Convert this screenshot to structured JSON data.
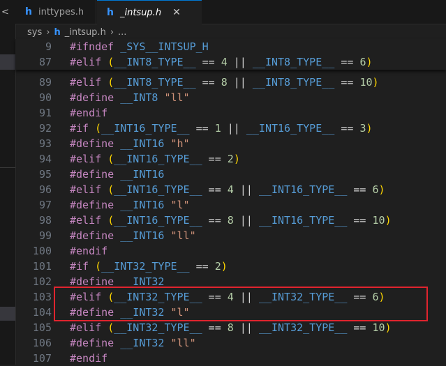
{
  "tabs": [
    {
      "label": "inttypes.h",
      "icon": "h-file-icon",
      "active": false
    },
    {
      "label": "_intsup.h",
      "icon": "h-file-icon",
      "active": true
    }
  ],
  "tab_close_glyph": "✕",
  "breadcrumb": {
    "folder": "sys",
    "file": "_intsup.h",
    "more": "..."
  },
  "icons": {
    "file_letter": "h"
  },
  "colors": {
    "highlight_border": "#e0242e",
    "accent": "#3794ff"
  },
  "sticky_lines": [
    {
      "num": "9",
      "parts": [
        [
          "kw",
          "#ifndef"
        ],
        [
          "op",
          " "
        ],
        [
          "mac",
          "_SYS__INTSUP_H"
        ]
      ]
    },
    {
      "num": "87",
      "parts": [
        [
          "kw",
          "#elif"
        ],
        [
          "op",
          " "
        ],
        [
          "pa",
          "("
        ],
        [
          "mac",
          "__INT8_TYPE__"
        ],
        [
          "op",
          " == "
        ],
        [
          "num",
          "4"
        ],
        [
          "op",
          " || "
        ],
        [
          "mac",
          "__INT8_TYPE__"
        ],
        [
          "op",
          " == "
        ],
        [
          "num",
          "6"
        ],
        [
          "pa",
          ")"
        ]
      ]
    }
  ],
  "lines": [
    {
      "num": "89",
      "parts": [
        [
          "kw",
          "#elif"
        ],
        [
          "op",
          " "
        ],
        [
          "pa",
          "("
        ],
        [
          "mac",
          "__INT8_TYPE__"
        ],
        [
          "op",
          " == "
        ],
        [
          "num",
          "8"
        ],
        [
          "op",
          " || "
        ],
        [
          "mac",
          "__INT8_TYPE__"
        ],
        [
          "op",
          " == "
        ],
        [
          "num",
          "10"
        ],
        [
          "pa",
          ")"
        ]
      ]
    },
    {
      "num": "90",
      "parts": [
        [
          "kw",
          "#define"
        ],
        [
          "op",
          " "
        ],
        [
          "mac",
          "__INT8"
        ],
        [
          "op",
          " "
        ],
        [
          "str",
          "\"ll\""
        ]
      ]
    },
    {
      "num": "91",
      "parts": [
        [
          "kw",
          "#endif"
        ]
      ]
    },
    {
      "num": "92",
      "parts": [
        [
          "kw",
          "#if"
        ],
        [
          "op",
          " "
        ],
        [
          "pa",
          "("
        ],
        [
          "mac",
          "__INT16_TYPE__"
        ],
        [
          "op",
          " == "
        ],
        [
          "num",
          "1"
        ],
        [
          "op",
          " || "
        ],
        [
          "mac",
          "__INT16_TYPE__"
        ],
        [
          "op",
          " == "
        ],
        [
          "num",
          "3"
        ],
        [
          "pa",
          ")"
        ]
      ]
    },
    {
      "num": "93",
      "parts": [
        [
          "kw",
          "#define"
        ],
        [
          "op",
          " "
        ],
        [
          "mac",
          "__INT16"
        ],
        [
          "op",
          " "
        ],
        [
          "str",
          "\"h\""
        ]
      ]
    },
    {
      "num": "94",
      "parts": [
        [
          "kw",
          "#elif"
        ],
        [
          "op",
          " "
        ],
        [
          "pa",
          "("
        ],
        [
          "mac",
          "__INT16_TYPE__"
        ],
        [
          "op",
          " == "
        ],
        [
          "num",
          "2"
        ],
        [
          "pa",
          ")"
        ]
      ]
    },
    {
      "num": "95",
      "parts": [
        [
          "kw",
          "#define"
        ],
        [
          "op",
          " "
        ],
        [
          "mac",
          "__INT16"
        ]
      ]
    },
    {
      "num": "96",
      "parts": [
        [
          "kw",
          "#elif"
        ],
        [
          "op",
          " "
        ],
        [
          "pa",
          "("
        ],
        [
          "mac",
          "__INT16_TYPE__"
        ],
        [
          "op",
          " == "
        ],
        [
          "num",
          "4"
        ],
        [
          "op",
          " || "
        ],
        [
          "mac",
          "__INT16_TYPE__"
        ],
        [
          "op",
          " == "
        ],
        [
          "num",
          "6"
        ],
        [
          "pa",
          ")"
        ]
      ]
    },
    {
      "num": "97",
      "parts": [
        [
          "kw",
          "#define"
        ],
        [
          "op",
          " "
        ],
        [
          "mac",
          "__INT16"
        ],
        [
          "op",
          " "
        ],
        [
          "str",
          "\"l\""
        ]
      ]
    },
    {
      "num": "98",
      "parts": [
        [
          "kw",
          "#elif"
        ],
        [
          "op",
          " "
        ],
        [
          "pa",
          "("
        ],
        [
          "mac",
          "__INT16_TYPE__"
        ],
        [
          "op",
          " == "
        ],
        [
          "num",
          "8"
        ],
        [
          "op",
          " || "
        ],
        [
          "mac",
          "__INT16_TYPE__"
        ],
        [
          "op",
          " == "
        ],
        [
          "num",
          "10"
        ],
        [
          "pa",
          ")"
        ]
      ]
    },
    {
      "num": "99",
      "parts": [
        [
          "kw",
          "#define"
        ],
        [
          "op",
          " "
        ],
        [
          "mac",
          "__INT16"
        ],
        [
          "op",
          " "
        ],
        [
          "str",
          "\"ll\""
        ]
      ]
    },
    {
      "num": "100",
      "parts": [
        [
          "kw",
          "#endif"
        ]
      ]
    },
    {
      "num": "101",
      "parts": [
        [
          "kw",
          "#if"
        ],
        [
          "op",
          " "
        ],
        [
          "pa",
          "("
        ],
        [
          "mac",
          "__INT32_TYPE__"
        ],
        [
          "op",
          " == "
        ],
        [
          "num",
          "2"
        ],
        [
          "pa",
          ")"
        ]
      ]
    },
    {
      "num": "102",
      "parts": [
        [
          "kw",
          "#define"
        ],
        [
          "op",
          " "
        ],
        [
          "mac",
          "__INT32"
        ]
      ]
    },
    {
      "num": "103",
      "parts": [
        [
          "kw",
          "#elif"
        ],
        [
          "op",
          " "
        ],
        [
          "pa",
          "("
        ],
        [
          "mac",
          "__INT32_TYPE__"
        ],
        [
          "op",
          " == "
        ],
        [
          "num",
          "4"
        ],
        [
          "op",
          " || "
        ],
        [
          "mac",
          "__INT32_TYPE__"
        ],
        [
          "op",
          " == "
        ],
        [
          "num",
          "6"
        ],
        [
          "pa",
          ")"
        ]
      ]
    },
    {
      "num": "104",
      "parts": [
        [
          "kw",
          "#define"
        ],
        [
          "op",
          " "
        ],
        [
          "mac",
          "__INT32"
        ],
        [
          "op",
          " "
        ],
        [
          "str",
          "\"l\""
        ]
      ]
    },
    {
      "num": "105",
      "parts": [
        [
          "kw",
          "#elif"
        ],
        [
          "op",
          " "
        ],
        [
          "pa",
          "("
        ],
        [
          "mac",
          "__INT32_TYPE__"
        ],
        [
          "op",
          " == "
        ],
        [
          "num",
          "8"
        ],
        [
          "op",
          " || "
        ],
        [
          "mac",
          "__INT32_TYPE__"
        ],
        [
          "op",
          " == "
        ],
        [
          "num",
          "10"
        ],
        [
          "pa",
          ")"
        ]
      ]
    },
    {
      "num": "106",
      "parts": [
        [
          "kw",
          "#define"
        ],
        [
          "op",
          " "
        ],
        [
          "mac",
          "__INT32"
        ],
        [
          "op",
          " "
        ],
        [
          "str",
          "\"ll\""
        ]
      ]
    },
    {
      "num": "107",
      "parts": [
        [
          "kw",
          "#endif"
        ]
      ]
    }
  ]
}
